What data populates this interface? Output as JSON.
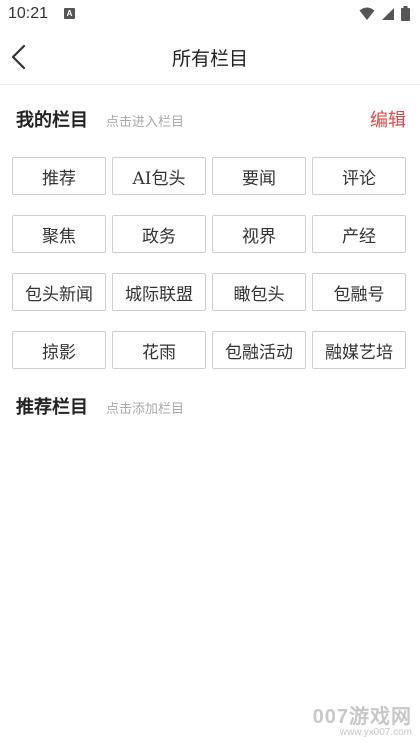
{
  "status_bar": {
    "time": "10:21",
    "notification_badge": "A",
    "icons": [
      "wifi-icon",
      "signal-icon",
      "battery-icon"
    ]
  },
  "nav": {
    "title": "所有栏目",
    "back_icon": "chevron-left-icon"
  },
  "my_channels": {
    "title": "我的栏目",
    "hint": "点击进入栏目",
    "edit_label": "编辑",
    "items": [
      "推荐",
      "AI包头",
      "要闻",
      "评论",
      "聚焦",
      "政务",
      "视界",
      "产经",
      "包头新闻",
      "城际联盟",
      "瞰包头",
      "包融号",
      "掠影",
      "花雨",
      "包融活动",
      "融媒艺培"
    ]
  },
  "recommended_channels": {
    "title": "推荐栏目",
    "hint": "点击添加栏目",
    "items": []
  },
  "watermark": {
    "main": "007游戏网",
    "sub": "www.yx007.com"
  },
  "colors": {
    "accent": "#e0494b",
    "border": "#cfcfcf",
    "hint": "#aaaaaa"
  }
}
